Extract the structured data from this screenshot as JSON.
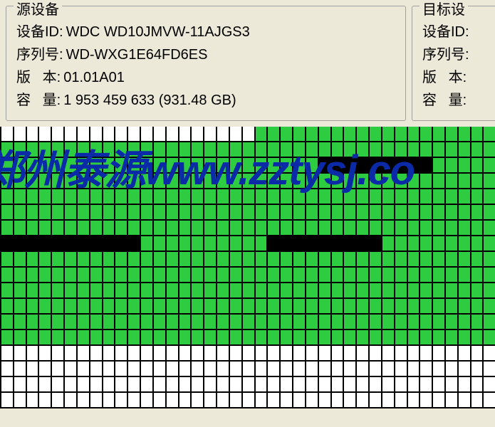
{
  "source": {
    "title": "源设备",
    "device_id_label": "设备ID:",
    "device_id": "WDC WD10JMVW-11AJGS3",
    "serial_label": "序列号:",
    "serial": "WD-WXG1E64FD6ES",
    "version_label": "版   本:",
    "version": "01.01A01",
    "capacity_label": "容   量:",
    "capacity": "1 953 459 633 (931.48 GB)"
  },
  "target": {
    "title": "目标设",
    "device_id_label": "设备ID:",
    "serial_label": "序列号:",
    "version_label": "版   本:",
    "capacity_label": "容   量:"
  },
  "watermark": "郑州泰源www.zztysj.co",
  "grid": {
    "cols": 39,
    "colors": {
      "w": "#ffffff",
      "g": "#2ecc40",
      "k": "#000000"
    },
    "rows": [
      "wwwwwwwwwwwwwwwwwwwwggggggggggggggggggg",
      "ggggggggggggggggggggggggggggggggggggggg",
      "gggggggggggggggggggggggggkkkkkkkkkggggg",
      "ggggggggggggggggggggggggggggggggggggggg",
      "ggggggggggggggggggggggggggggggggggggggg",
      "ggggggggggggggggggggggggggggggggggggggg",
      "ggggggggggggggggggggggggggggggggggggggg",
      "kkkkkkkkkkkggggggggggkkkkkkkkkggggggggg",
      "ggggggggggggggggggggggggggggggggggggggg",
      "ggggggggggggggggggggggggggggggggggggggg",
      "ggggggggggggggggggggggggggggggggggggggg",
      "ggggggggggggggggggggggggggggggggggggggg",
      "ggggggggggggggggggggggggggggggggggggggg",
      "ggggggggggggggggggggggggggggggggggggggg",
      "wwwwwwwwwwwwwwwwwwwwwwwwwwwwwwwwwwwwwww",
      "wwwwwwwwwwwwwwwwwwwwwwwwwwwwwwwwwwwwwww",
      "wwwwwwwwwwwwwwwwwwwwwwwwwwwwwwwwwwwwwww",
      "wwwwwwwwwwwwwwwwwwwwwwwwwwwwwwwwwwwwwww"
    ]
  }
}
